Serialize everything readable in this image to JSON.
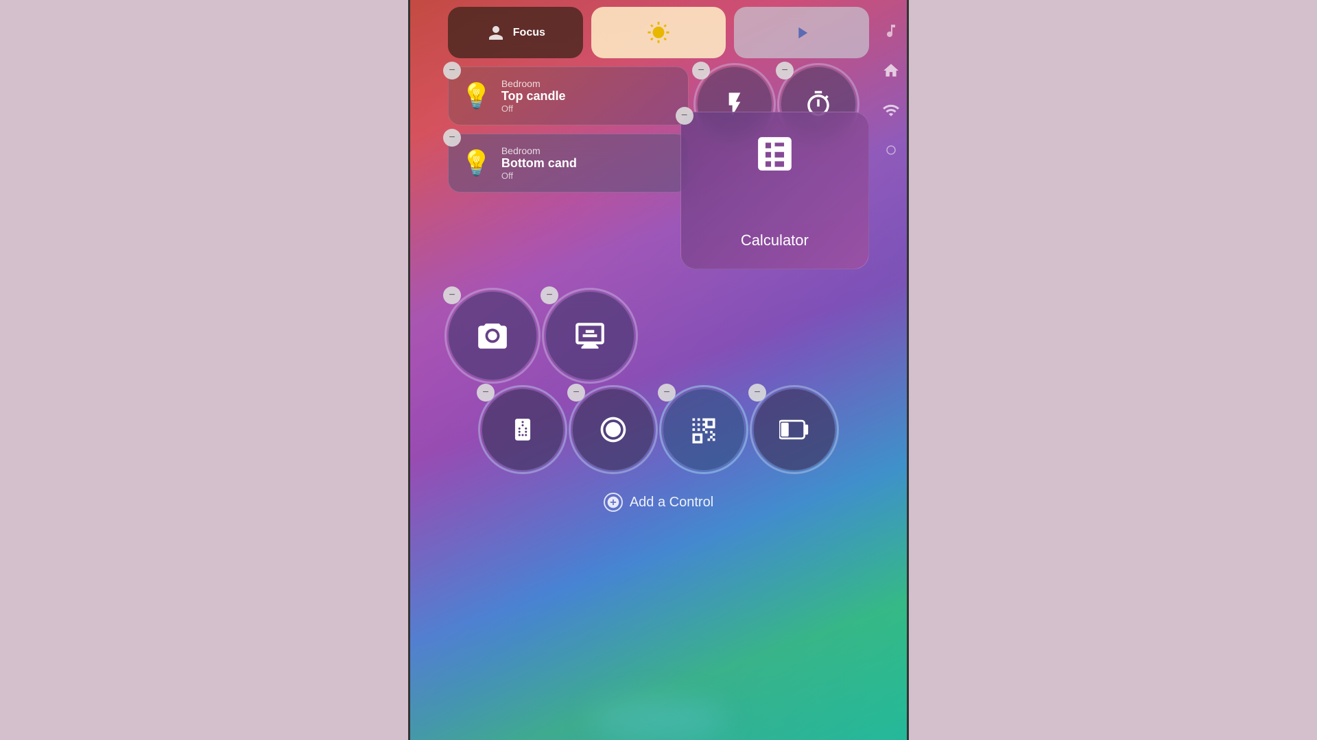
{
  "sidebar": {
    "music_icon": "♪",
    "home_icon": "⌂",
    "radio_icon": "◉",
    "dot_icon": "○"
  },
  "top_row": {
    "focus_label": "Focus",
    "focus_icon": "👤",
    "brightness_icon": "☀",
    "media_icon": "▶"
  },
  "light1": {
    "room": "Bedroom",
    "name": "Top candle",
    "status": "Off",
    "icon": "💡"
  },
  "light2": {
    "room": "Bedroom",
    "name": "Bottom cand",
    "status": "Off",
    "icon": "💡"
  },
  "calculator": {
    "label": "Calculator",
    "icon": "🧮"
  },
  "add_control": {
    "label": "Add a Control"
  },
  "tiles": {
    "flashlight": "🔦",
    "timer": "⏱",
    "camera": "📷",
    "screen_mirror": "⧉",
    "remote": "📱",
    "record": "⏺",
    "qr": "▣",
    "battery": "🔋"
  }
}
